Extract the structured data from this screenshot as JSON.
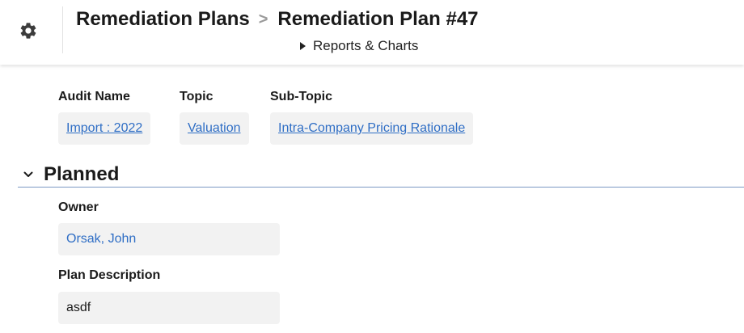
{
  "header": {
    "breadcrumb_parent": "Remediation Plans",
    "breadcrumb_separator": ">",
    "title": "Remediation Plan #47",
    "subnav_label": "Reports & Charts"
  },
  "summary": {
    "audit_name_label": "Audit Name",
    "audit_name_value": "Import : 2022",
    "topic_label": "Topic",
    "topic_value": "Valuation",
    "subtopic_label": "Sub-Topic",
    "subtopic_value": "Intra-Company Pricing Rationale"
  },
  "planned": {
    "section_title": "Planned",
    "owner_label": "Owner",
    "owner_value": "Orsak, John",
    "description_label": "Plan Description",
    "description_value": "asdf"
  },
  "colors": {
    "link": "#2f6ec5",
    "field_bg": "#f2f2f2",
    "section_rule": "#7b98c4"
  },
  "icons": {
    "settings": "gear-icon",
    "collapse": "chevron-down-icon",
    "subnav": "caret-right-icon"
  }
}
